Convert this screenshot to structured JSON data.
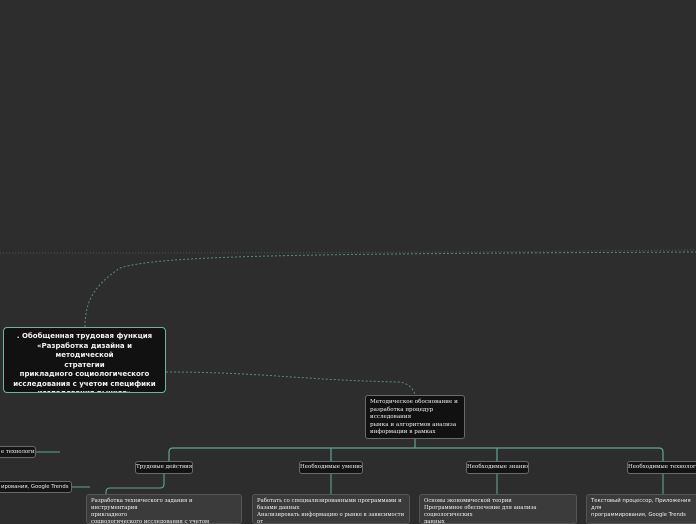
{
  "main_node": {
    "text": ". Обобщенная трудовая функция\n«Разработка дизайна и методической\nстратегии\nприкладного социологического\nисследования с учетом специфики\nисследования рынков»"
  },
  "method_node": {
    "text": "Методическое обоснование и\nразработка процедур исследования\nрынка и алгоритмов анализа\nинформации в рамках прикладного\nсоциологического исследования"
  },
  "categories": [
    {
      "label": "Трудовые действия"
    },
    {
      "label": "Необходимые умения"
    },
    {
      "label": "Необходимые знания"
    },
    {
      "label": "Необходимые технологии"
    }
  ],
  "leaves": [
    {
      "text": "Разработка технического задания и инструментария\nприкладного\nсоциологического исследования с учетом специфики"
    },
    {
      "text": "Работать со специализированными программами и\nбазами данных\nАнализировать информацию о рынке в зависимости от"
    },
    {
      "text": "Основы экономической теории\nПрограммное обеспечение для анализа социологических\nданных"
    },
    {
      "text": "Текстовый процессор, Приложения для\nпрограммирования, Google Trends"
    }
  ],
  "left_nodes": [
    {
      "text": "е технологии"
    },
    {
      "text": "ирования, Google Trends"
    }
  ],
  "colors": {
    "background": "#2d2d2e",
    "connector": "#5ea495",
    "dashed_connector": "#4a7a72"
  }
}
